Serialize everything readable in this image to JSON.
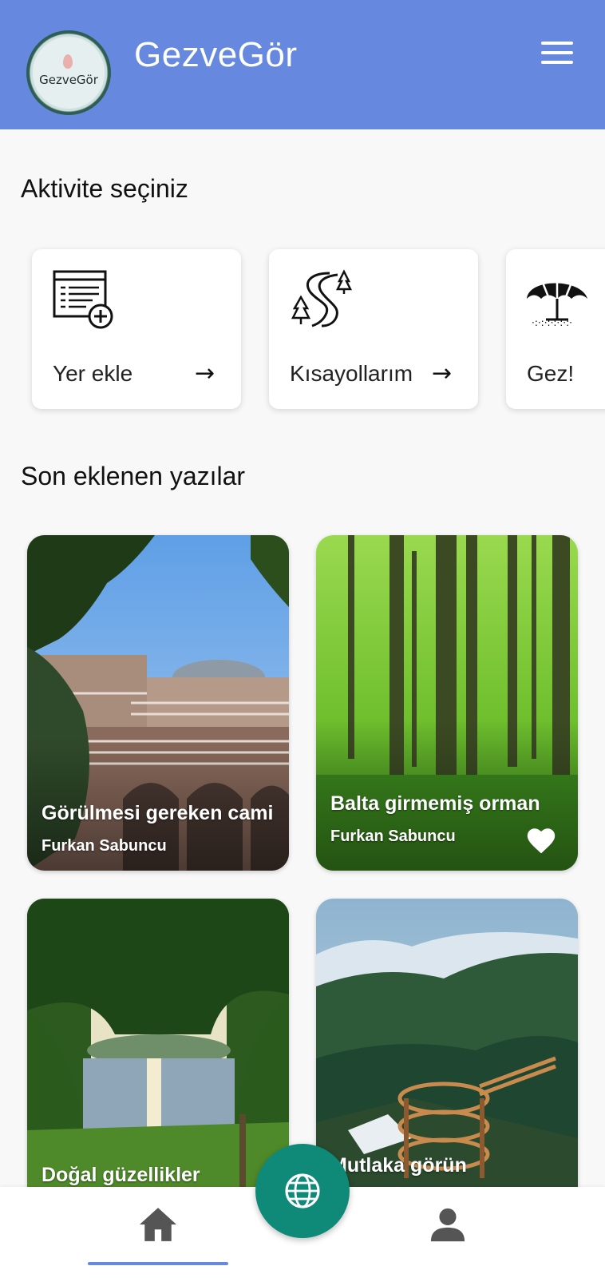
{
  "header": {
    "logo_text": "GezveGör",
    "app_title": "GezveGör",
    "menu_icon": "hamburger-menu-icon",
    "brand_color": "#6689df"
  },
  "activities": {
    "title": "Aktivite seçiniz",
    "items": [
      {
        "label": "Yer ekle",
        "icon": "add-place-list-icon"
      },
      {
        "label": "Kısayollarım",
        "icon": "winding-road-trees-icon"
      },
      {
        "label": "Gez!",
        "icon": "beach-umbrella-icon"
      }
    ]
  },
  "posts": {
    "title": "Son eklenen yazılar",
    "items": [
      {
        "title": "Görülmesi gereken cami",
        "author": "Furkan Sabuncu"
      },
      {
        "title": "Balta girmemiş orman",
        "author": "Furkan Sabuncu",
        "liked": true
      },
      {
        "title": "Doğal güzellikler",
        "author": ""
      },
      {
        "title": "Mutlaka görün",
        "author": ""
      }
    ]
  },
  "bottom_nav": {
    "home_icon": "home-icon",
    "profile_icon": "person-icon",
    "fab_icon": "globe-icon",
    "fab_color": "#0f8a79",
    "active": "home"
  }
}
